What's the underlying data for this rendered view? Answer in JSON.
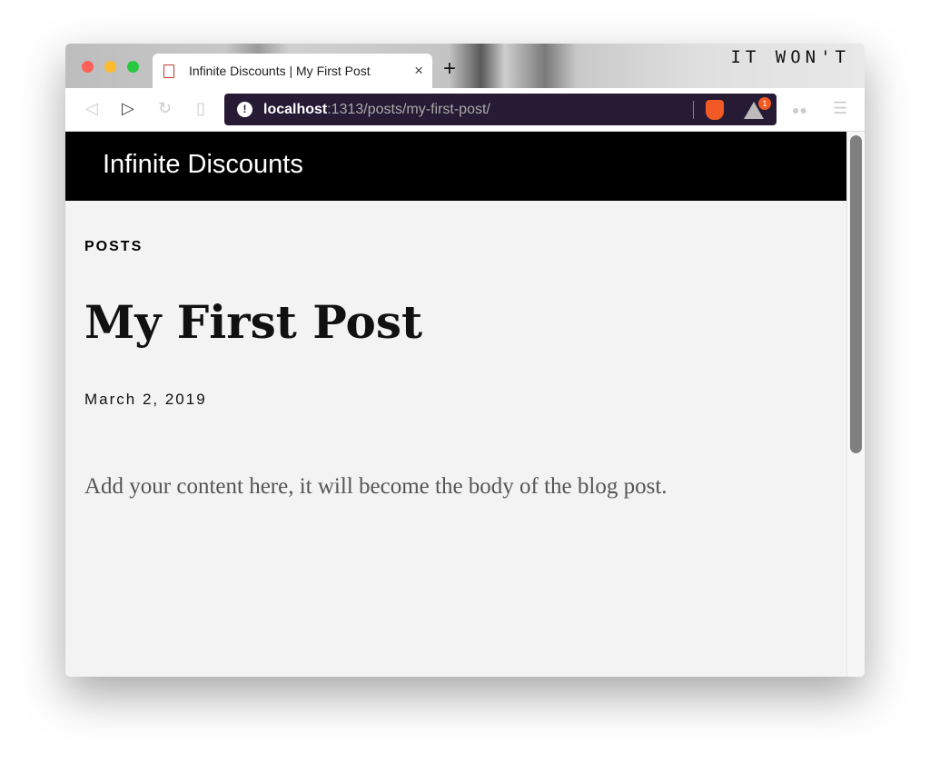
{
  "wallpaper_text": "IT WON'T",
  "tab": {
    "title": "Infinite Discounts | My First Post",
    "close": "×",
    "new_tab": "+"
  },
  "toolbar": {
    "url_host": "localhost",
    "url_rest": ":1313/posts/my-first-post/",
    "rewards_badge": "1"
  },
  "site": {
    "title": "Infinite Discounts"
  },
  "post": {
    "section": "POSTS",
    "title": "My First Post",
    "date": "March 2, 2019",
    "body": "Add your content here, it will become the body of the blog post."
  },
  "colors": {
    "url_bar": "#261a35",
    "brave": "#f15a24",
    "header": "#000000",
    "page_bg": "#f3f3f3"
  }
}
